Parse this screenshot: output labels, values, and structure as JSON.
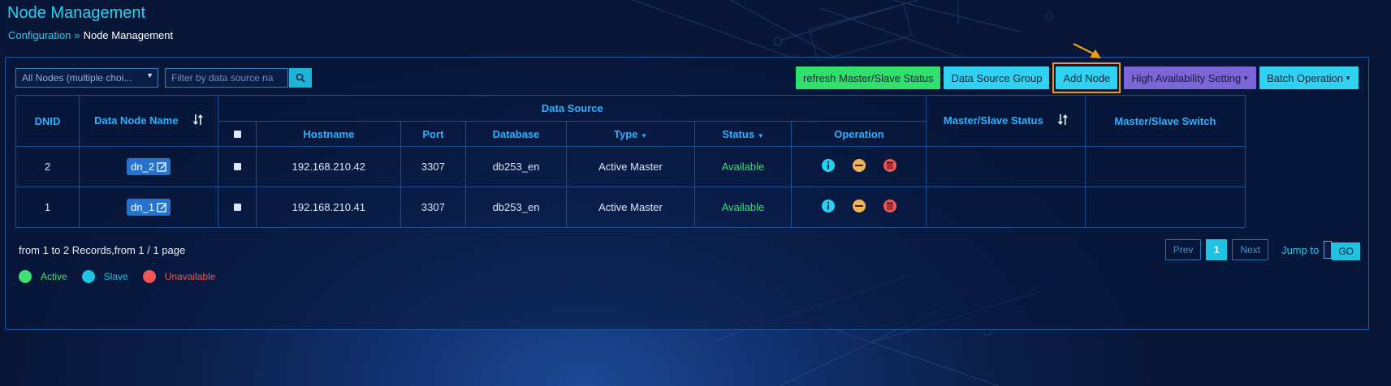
{
  "page": {
    "title": "Node Management",
    "breadcrumb": {
      "parent": "Configuration",
      "separator": "»",
      "current": "Node Management"
    }
  },
  "filters": {
    "node_select_value": "All Nodes (multiple choi...",
    "search_placeholder": "Filter by data source na"
  },
  "toolbar": {
    "refresh_label": "refresh Master/Slave Status",
    "data_source_group_label": "Data Source Group",
    "add_node_label": "Add Node",
    "high_availability_label": "High Availability Setting",
    "batch_operation_label": "Batch Operation"
  },
  "table": {
    "headers": {
      "dnid": "DNID",
      "data_node_name": "Data Node Name",
      "data_source": "Data Source",
      "hostname": "Hostname",
      "port": "Port",
      "database": "Database",
      "type": "Type",
      "status": "Status",
      "operation": "Operation",
      "master_slave_status": "Master/Slave Status",
      "master_slave_switch": "Master/Slave Switch"
    },
    "rows": [
      {
        "dnid": "2",
        "name": "dn_2",
        "hostname": "192.168.210.42",
        "port": "3307",
        "database": "db253_en",
        "type": "Active Master",
        "status": "Available",
        "master_slave_status": "",
        "master_slave_switch": ""
      },
      {
        "dnid": "1",
        "name": "dn_1",
        "hostname": "192.168.210.41",
        "port": "3307",
        "database": "db253_en",
        "type": "Active Master",
        "status": "Available",
        "master_slave_status": "",
        "master_slave_switch": ""
      }
    ]
  },
  "footer": {
    "records_text": "from 1 to 2 Records,from 1 / 1 page",
    "legend": [
      {
        "label": "Active",
        "color": "#3ee272"
      },
      {
        "label": "Slave",
        "color": "#1fc3e4"
      },
      {
        "label": "Unavailable",
        "color": "#f25656"
      }
    ]
  },
  "pagination": {
    "prev_label": "Prev",
    "current_page": "1",
    "next_label": "Next",
    "jump_label": "Jump to",
    "go_label": "GO"
  },
  "colors": {
    "accent": "#26d3ee",
    "header_text": "#2bb3ff",
    "available": "#34e36a",
    "highlight_border": "#f19a1c",
    "info_icon": "#22d2f0",
    "disable_icon": "#f5b356",
    "delete_icon": "#f25656"
  },
  "icons": [
    "search-icon",
    "sort-icon",
    "edit-icon",
    "info-icon",
    "disable-icon",
    "delete-icon",
    "arrow-pointer-icon"
  ]
}
